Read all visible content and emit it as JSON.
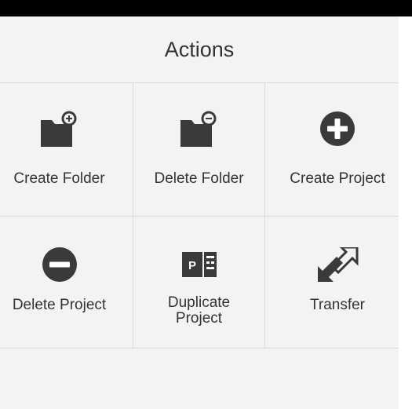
{
  "header": {
    "title": "Actions"
  },
  "actions": [
    {
      "label": "Create Folder",
      "icon": "folder-add-icon"
    },
    {
      "label": "Delete Folder",
      "icon": "folder-remove-icon"
    },
    {
      "label": "Create Project",
      "icon": "plus-circle-icon"
    },
    {
      "label": "Delete Project",
      "icon": "minus-circle-icon"
    },
    {
      "label": "Duplicate Project",
      "icon": "duplicate-project-icon"
    },
    {
      "label": "Transfer",
      "icon": "transfer-icon"
    }
  ],
  "colors": {
    "icon": "#3a3a3a",
    "panel_bg": "#f3f3f3",
    "border": "#d9d9d9",
    "text": "#333333"
  }
}
